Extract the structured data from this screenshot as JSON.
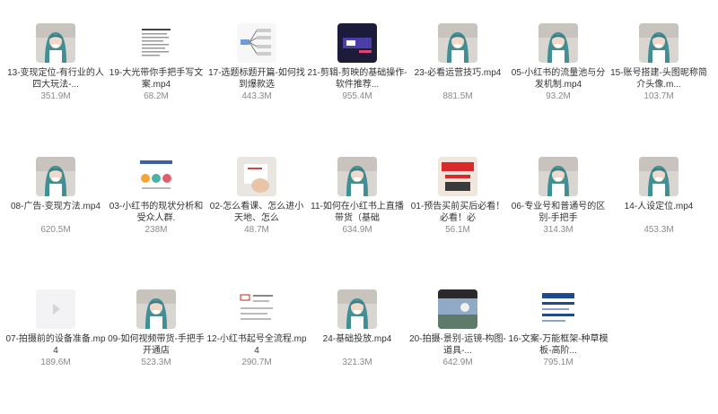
{
  "files": [
    {
      "name": "13-变现定位-有行业的人四大玩法-...",
      "size": "351.9M",
      "thumb": "person"
    },
    {
      "name": "19-大光带你手把手写文案.mp4",
      "size": "68.2M",
      "thumb": "doc"
    },
    {
      "name": "17-选题标题开篇-如何找到爆款选",
      "size": "443.3M",
      "thumb": "mindmap"
    },
    {
      "name": "21-剪辑-剪映的基础操作-软件推荐...",
      "size": "955.4M",
      "thumb": "dark"
    },
    {
      "name": "23-必看运营技巧.mp4",
      "size": "881.5M",
      "thumb": "person"
    },
    {
      "name": "05-小红书的流量池与分发机制.mp4",
      "size": "93.2M",
      "thumb": "person"
    },
    {
      "name": "15-账号搭建-头图昵称简介头像.m...",
      "size": "103.7M",
      "thumb": "person"
    },
    {
      "name": "08-广告-变现方法.mp4",
      "size": "620.5M",
      "thumb": "person"
    },
    {
      "name": "03-小红书的现状分析和受众人群.",
      "size": "238M",
      "thumb": "chart"
    },
    {
      "name": "02-怎么看课、怎么进小天地、怎么",
      "size": "48.7M",
      "thumb": "hand"
    },
    {
      "name": "11-如何在小红书上直播带货（基础",
      "size": "634.9M",
      "thumb": "person"
    },
    {
      "name": "01-预告买前买后必看！必看！必",
      "size": "56.1M",
      "thumb": "promo"
    },
    {
      "name": "06-专业号和普通号的区别-手把手",
      "size": "314.3M",
      "thumb": "person"
    },
    {
      "name": "14-人设定位.mp4",
      "size": "453.3M",
      "thumb": "person"
    },
    {
      "name": "07-拍摄前的设备准备.mp4",
      "size": "189.6M",
      "thumb": "blank"
    },
    {
      "name": "09-如何视频带货-手把手开通店",
      "size": "523.3M",
      "thumb": "person"
    },
    {
      "name": "12-小红书起号全流程.mp4",
      "size": "290.7M",
      "thumb": "flow"
    },
    {
      "name": "24-基础投放.mp4",
      "size": "321.3M",
      "thumb": "person"
    },
    {
      "name": "20-拍摄-景别-运镜-构图-道具-...",
      "size": "642.9M",
      "thumb": "photo"
    },
    {
      "name": "16-文案-万能框架-种草模板-高阶...",
      "size": "795.1M",
      "thumb": "slides"
    }
  ]
}
